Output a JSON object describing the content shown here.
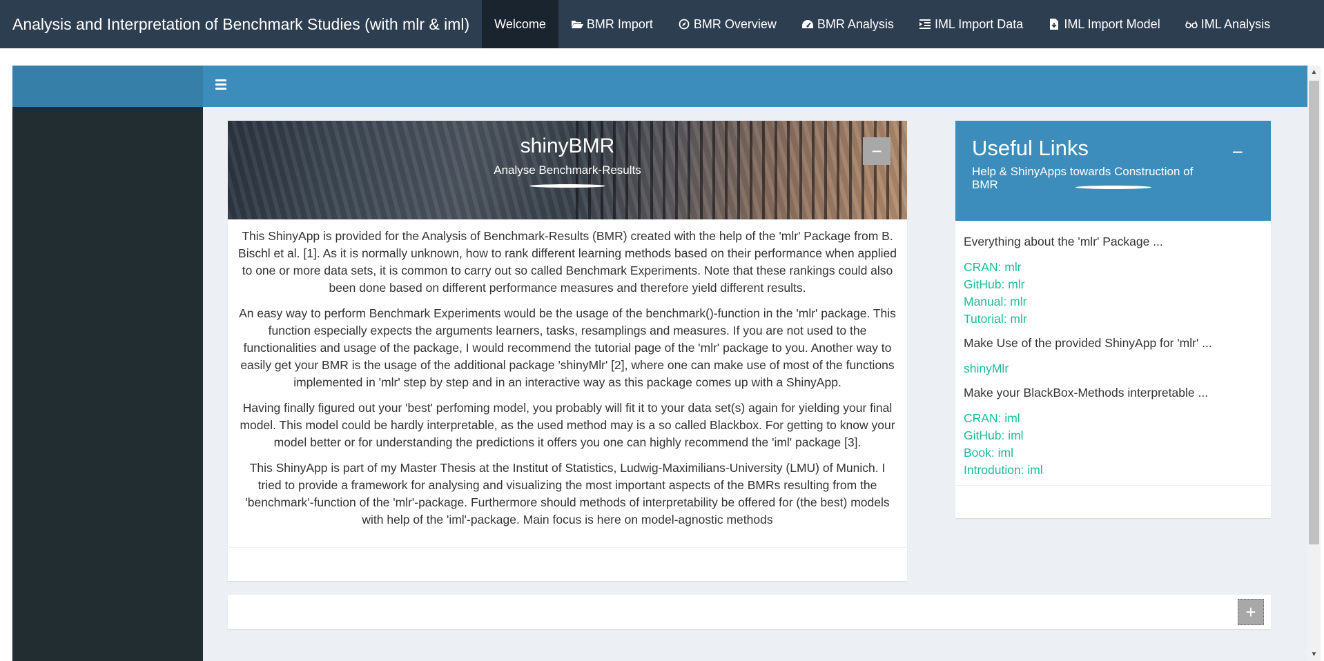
{
  "navbar": {
    "brand": "Analysis and Interpretation of Benchmark Studies (with mlr & iml)",
    "items": [
      {
        "label": "Welcome",
        "icon": null
      },
      {
        "label": "BMR Import",
        "icon": "folder-open-icon"
      },
      {
        "label": "BMR Overview",
        "icon": "compass-icon"
      },
      {
        "label": "BMR Analysis",
        "icon": "dashboard-gauge-icon"
      },
      {
        "label": "IML Import Data",
        "icon": "indent-list-icon"
      },
      {
        "label": "IML Import Model",
        "icon": "file-import-icon"
      },
      {
        "label": "IML Analysis",
        "icon": "glasses-icon"
      }
    ]
  },
  "main_box": {
    "title": "shinyBMR",
    "subtitle": "Analyse Benchmark-Results",
    "collapse_label": "−",
    "paragraphs": [
      "This ShinyApp is provided for the Analysis of Benchmark-Results (BMR) created with the help of the 'mlr' Package from B. Bischl et al. [1]. As it is normally unknown, how to rank different learning methods based on their performance when applied to one or more data sets, it is common to carry out so called Benchmark Experiments. Note that these rankings could also been done based on different performance measures and therefore yield different results.",
      "An easy way to perform Benchmark Experiments would be the usage of the benchmark()-function in the 'mlr' package. This function especially expects the arguments learners, tasks, resamplings and measures. If you are not used to the functionalities and usage of the package, I would recommend the tutorial page of the 'mlr' package to you. Another way to easily get your BMR is the usage of the additional package 'shinyMlr' [2], where one can make use of most of the functions implemented in 'mlr' step by step and in an interactive way as this package comes up with a ShinyApp.",
      "Having finally figured out your 'best' perfoming model, you probably will fit it to your data set(s) again for yielding your final model. This model could be hardly interpretable, as the used method may is a so called Blackbox. For getting to know your model better or for understanding the predictions it offers you one can highly recommend the 'iml' package [3].",
      "This ShinyApp is part of my Master Thesis at the Institut of Statistics, Ludwig-Maximilians-University (LMU) of Munich. I tried to provide a framework for analysing and visualizing the most important aspects of the BMRs resulting from the 'benchmark'-function of the 'mlr'-package. Furthermore should methods of interpretability be offered for (the best) models with help of the 'iml'-package. Main focus is here on model-agnostic methods"
    ]
  },
  "links_box": {
    "title": "Useful Links",
    "subtitle": "Help & ShinyApps towards Construction of BMR",
    "collapse_label": "−",
    "group1_label": "Everything about the 'mlr' Package ...",
    "group1_links": [
      "CRAN: mlr",
      "GitHub: mlr",
      "Manual: mlr",
      "Tutorial: mlr"
    ],
    "group2_label": "Make Use of the provided ShinyApp for 'mlr' ...",
    "group2_links": [
      "shinyMlr"
    ],
    "group3_label": "Make your BlackBox-Methods interpretable ...",
    "group3_links": [
      "CRAN: iml",
      "GitHub: iml",
      "Book: iml",
      "Introdution: iml"
    ]
  },
  "bottom_box": {
    "expand_label": "+"
  },
  "colors": {
    "navbar": "#2c3e50",
    "navbar_active": "#1a242f",
    "header": "#3c8dbc",
    "sidebar": "#222d32",
    "link": "#18bc9c",
    "content_bg": "#ecf0f5"
  }
}
